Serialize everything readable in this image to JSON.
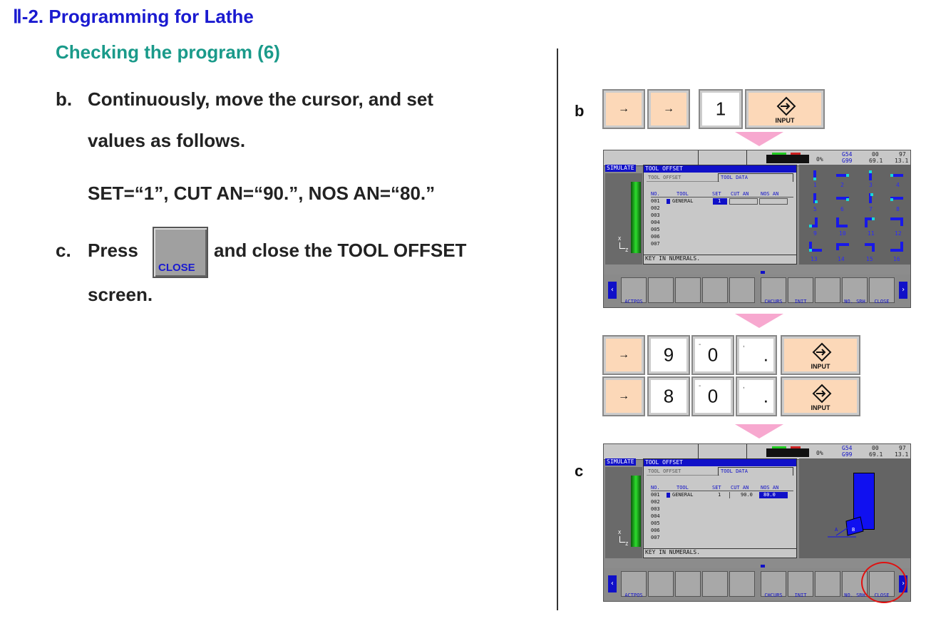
{
  "header": {
    "title": "Ⅱ-2. Programming for Lathe",
    "subtitle": "Checking the program (6)"
  },
  "instructions": {
    "b_marker": "b.",
    "b_line1": "Continuously, move the cursor, and set",
    "b_line2": "values as follows.",
    "b_values": "SET=“1”, CUT AN=“90.”, NOS AN=“80.”",
    "c_marker": "c.",
    "c_press": "Press",
    "c_after": "and close the TOOL OFFSET",
    "c_line2": "screen.",
    "close_key_label": "CLOSE"
  },
  "figure": {
    "step_b": "b",
    "step_c": "c",
    "keys_row1": {
      "arrow": "→",
      "digit": "1",
      "input": "INPUT"
    },
    "keys_row2": {
      "arrow": "→",
      "d1": "9",
      "d2": "0",
      "d3": ".",
      "input": "INPUT"
    },
    "keys_row3": {
      "arrow": "→",
      "d1": "8",
      "d2": "0",
      "d3": ".",
      "input": "INPUT"
    }
  },
  "screen1": {
    "readout_pct": "0%",
    "readout_g1": "G54",
    "readout_g2": "G99",
    "readout_c1a": "00",
    "readout_c1b": "69.1",
    "readout_c2a": "97",
    "readout_c2b": "13.1",
    "sim_tab": "SIMULATE",
    "window_title": "TOOL OFFSET",
    "tab1": "TOOL OFFSET",
    "tab2": "TOOL DATA",
    "col_no": "NO.",
    "col_tool": "TOOL",
    "col_set": "SET",
    "col_cut": "CUT AN",
    "col_nos": "NOS AN",
    "rows": [
      "001",
      "002",
      "003",
      "004",
      "005",
      "006",
      "007"
    ],
    "tool_name": "GENERAL",
    "set_value": "1",
    "message": "KEY IN NUMERALS.",
    "axis_x": "X",
    "axis_z": "Z",
    "softkeys": [
      "ACTPOS",
      "CHCURS",
      "INIT",
      "NO. SRH",
      "CLOSE"
    ],
    "orientation_numbers": [
      "1",
      "2",
      "3",
      "4",
      "5",
      "6",
      "7",
      "8",
      "9",
      "10",
      "11",
      "12",
      "13",
      "14",
      "15",
      "16"
    ]
  },
  "screen2": {
    "readout_pct": "0%",
    "readout_g1": "G54",
    "readout_g2": "G99",
    "readout_c1a": "00",
    "readout_c1b": "69.1",
    "readout_c2a": "97",
    "readout_c2b": "13.1",
    "sim_tab": "SIMULATE",
    "window_title": "TOOL OFFSET",
    "tab1": "TOOL OFFSET",
    "tab2": "TOOL DATA",
    "col_no": "NO.",
    "col_tool": "TOOL",
    "col_set": "SET",
    "col_cut": "CUT AN",
    "col_nos": "NOS AN",
    "rows": [
      "001",
      "002",
      "003",
      "004",
      "005",
      "006",
      "007"
    ],
    "tool_name": "GENERAL",
    "set_value": "1",
    "cut_value": "90.0",
    "nos_value": "80.0",
    "message": "KEY IN NUMERALS.",
    "axis_x": "X",
    "axis_z": "Z",
    "label_a": "A",
    "label_b": "B",
    "softkeys": [
      "ACTPOS",
      "CHCURS",
      "INIT",
      "NO. SRH",
      "CLOSE"
    ]
  },
  "colors": {
    "title": "#1a1ad0",
    "subtitle": "#1a9a8a",
    "key_orange": "#fcd8b8",
    "arrow_pink": "#f7a8cf",
    "screen_blue": "#1010c8",
    "highlight_red": "#e01010"
  }
}
